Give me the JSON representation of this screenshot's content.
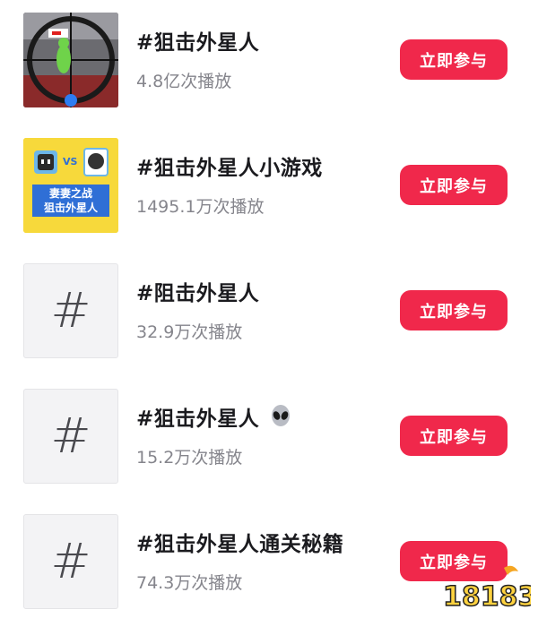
{
  "topics": [
    {
      "title": "#狙击外星人",
      "plays": "4.8亿次播放",
      "button": "立即参与",
      "thumb": "game-screenshot"
    },
    {
      "title": "#狙击外星人小游戏",
      "plays": "1495.1万次播放",
      "button": "立即参与",
      "thumb": "wife-battle-cover",
      "thumb_text": [
        "妻妻之战",
        "狙击外星人"
      ],
      "thumb_vs": "VS"
    },
    {
      "title": "#阻击外星人",
      "plays": "32.9万次播放",
      "button": "立即参与",
      "thumb": "hash",
      "thumb_glyph": "#"
    },
    {
      "title": "#狙击外星人",
      "plays": "15.2万次播放",
      "button": "立即参与",
      "thumb": "hash",
      "thumb_glyph": "#",
      "emoji": "alien-icon"
    },
    {
      "title": "#狙击外星人通关秘籍",
      "plays": "74.3万次播放",
      "button": "立即参与",
      "thumb": "hash",
      "thumb_glyph": "#"
    }
  ],
  "watermark": "18183",
  "colors": {
    "accent": "#f0284b",
    "title": "#1b1b1f",
    "subtext": "#85858c"
  }
}
